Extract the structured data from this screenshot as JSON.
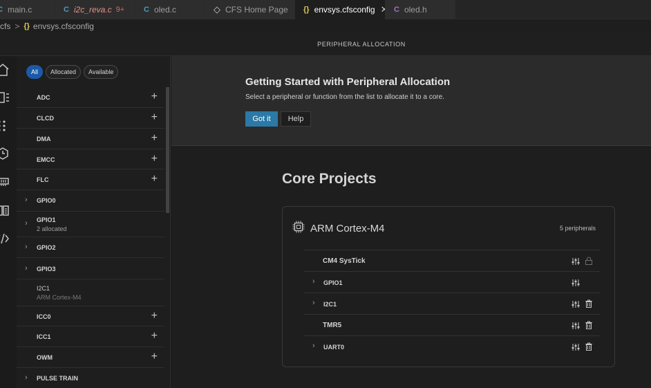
{
  "tabs": [
    {
      "icon": "C",
      "label": "main.c",
      "icon_color": "#519aba"
    },
    {
      "icon": "C",
      "label": "i2c_reva.c",
      "badge": "9+",
      "icon_color": "#519aba"
    },
    {
      "icon": "C",
      "label": "oled.c",
      "icon_color": "#519aba"
    },
    {
      "icon": "◇",
      "label": "CFS Home Page",
      "icon_color": "#cccccc"
    },
    {
      "icon": "{}",
      "label": "envsys.cfsconfig",
      "icon_color": "#e0c85b",
      "close": "✕"
    },
    {
      "icon": "C",
      "label": "oled.h",
      "icon_color": "#a074c4"
    }
  ],
  "breadcrumb": {
    "root": "cfs",
    "sep": ">",
    "braces": "{}",
    "file": "envsys.cfsconfig"
  },
  "panel": {
    "title": "PERIPHERAL ALLOCATION"
  },
  "activity_icons": [
    "home-icon",
    "peripherals-icon",
    "pins-icon",
    "clock-icon",
    "memory-icon",
    "docs-icon",
    "code-icon"
  ],
  "filters": [
    "All",
    "Allocated",
    "Available"
  ],
  "peripherals": [
    {
      "name": "ADC",
      "action": "+"
    },
    {
      "name": "CLCD",
      "action": "+"
    },
    {
      "name": "DMA",
      "action": "+"
    },
    {
      "name": "EMCC",
      "action": "+"
    },
    {
      "name": "FLC",
      "action": "+"
    },
    {
      "name": "GPIO0",
      "chevron": "›"
    },
    {
      "name": "GPIO1",
      "chevron": "›",
      "sub": "2 allocated"
    },
    {
      "name": "GPIO2",
      "chevron": "›"
    },
    {
      "name": "GPIO3",
      "chevron": "›"
    },
    {
      "name": "I2C1",
      "sub": "ARM Cortex-M4",
      "dim": true
    },
    {
      "name": "ICC0",
      "action": "+"
    },
    {
      "name": "ICC1",
      "action": "+"
    },
    {
      "name": "OWM",
      "action": "+"
    },
    {
      "name": "PULSE TRAIN",
      "chevron": "›"
    }
  ],
  "getting_started": {
    "title": "Getting Started with Peripheral Allocation",
    "description": "Select a peripheral or function from the list to allocate it to a core.",
    "got_it": "Got it",
    "help": "Help"
  },
  "core_projects": {
    "title": "Core Projects",
    "core": {
      "name": "ARM Cortex-M4",
      "count": "5 peripherals",
      "rows": [
        {
          "name": "CM4 SysTick",
          "side": "lock-icon"
        },
        {
          "name": "GPIO1",
          "chevron": "›",
          "side": ""
        },
        {
          "name": "I2C1",
          "chevron": "›",
          "side": "trash-icon"
        },
        {
          "name": "TMR5",
          "side": "trash-icon"
        },
        {
          "name": "UART0",
          "chevron": "›",
          "side": "trash-icon"
        }
      ]
    }
  },
  "colors": {
    "accent": "#2b79a6",
    "chip_active": "#1a5aa8"
  }
}
